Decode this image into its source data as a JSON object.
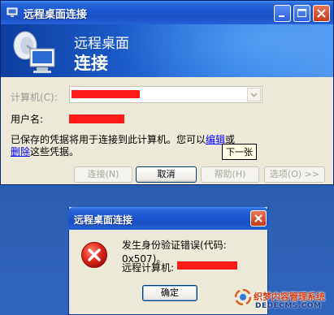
{
  "main_window": {
    "title": "远程桌面连接",
    "banner_line1": "远程桌面",
    "banner_line2": "连接",
    "computer_label": "计算机(C):",
    "user_label": "用户名:",
    "info_text_1": "已保存的凭据将用于连接到此计算机。您可以",
    "edit_link": "编辑",
    "info_text_2": "或",
    "delete_link": "删除",
    "info_text_3": "这些凭据。",
    "tooltip": "下一张",
    "buttons": {
      "connect": "连接(N)",
      "cancel": "取消",
      "help": "帮助(H)",
      "options": "选项(O) >>"
    }
  },
  "error_dialog": {
    "title": "远程桌面连接",
    "message": "发生身份验证错误(代码: 0x507)。",
    "remote_label": "远程计算机:",
    "ok_button": "确定"
  },
  "watermark": {
    "line1": "织梦内容管理系统",
    "line2": "DEDECMS.COM"
  },
  "colors": {
    "titlebar": "#1d58d0",
    "window_bg": "#ece9d8",
    "redaction": "#ff1a1a",
    "desktop": "#2a5db0"
  },
  "icons": {
    "title": "remote-desktop-icon",
    "banner": "monitor-satellite-icon",
    "error": "error-x-icon"
  }
}
